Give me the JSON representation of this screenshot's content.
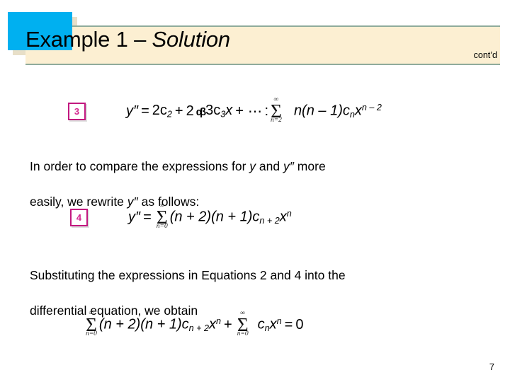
{
  "header": {
    "title_plain": "Example 1 – ",
    "title_italic": "Solution",
    "contd": "cont’d",
    "accent_color": "#00b0f0",
    "banner_color": "#fcefd2",
    "banner_rule_color": "#8fab9b"
  },
  "equation3": {
    "badge": "3",
    "lhs": "y″",
    "equals": "=",
    "term1": "2c",
    "term1_sub": "2",
    "plus1": "+",
    "term2": "2",
    "artifact_glyph": "αβ",
    "term3": "3c",
    "term3_sub": "3",
    "term3_var": "x",
    "plus2": "+",
    "dots": "⋯",
    "colon": ":",
    "sum_top": "∞",
    "sum_symbol": "Σ",
    "sum_bottom": "n=2",
    "summand_a": "n(n – 1)c",
    "summand_a_sub": "n",
    "summand_x": "x",
    "summand_exp": "n – 2"
  },
  "paragraph1": "In order to compare the expressions for y and y″ more\neasily, we rewrite y″ as follows:",
  "paragraph1_parts": {
    "p1": "In order to compare the expressions for ",
    "v1": "y",
    "p2": " and ",
    "v2": "y″",
    "p3": " more",
    "p4": "easily, we rewrite ",
    "v3": "y″",
    "p5": " as follows:"
  },
  "equation4": {
    "badge": "4",
    "lhs": "y″",
    "equals": "=",
    "sum_top": "∞",
    "sum_symbol": "Σ",
    "sum_bottom": "n=0",
    "factor1": "(n + 2)(n + 1)c",
    "factor1_sub": "n + 2",
    "var": "x",
    "exp": "n"
  },
  "paragraph2_parts": {
    "p1": "Substituting the expressions in Equations 2 and 4 into the",
    "p2": "differential equation, we obtain"
  },
  "equation5": {
    "sum1_top": "∞",
    "sum1_symbol": "Σ",
    "sum1_bottom": "n=0",
    "factor1": "(n + 2)(n + 1)c",
    "factor1_sub": "n + 2",
    "var1": "x",
    "exp1": "n",
    "plus": "+",
    "sum2_top": "∞",
    "sum2_symbol": "Σ",
    "sum2_bottom": "n=0",
    "factor2": "c",
    "factor2_sub": "n",
    "var2": "x",
    "exp2": "n",
    "equals": "=",
    "rhs": "0"
  },
  "page_number": "7"
}
